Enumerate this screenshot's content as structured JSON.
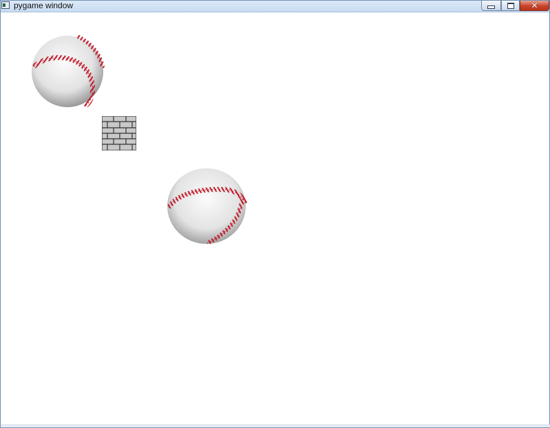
{
  "window": {
    "title": "pygame window",
    "icons": {
      "app": "pygame-app-icon",
      "minimize": "minimize-icon",
      "maximize": "maximize-icon",
      "close": "close-icon"
    },
    "close_color": "#c7432a"
  },
  "scene": {
    "background": "#ffffff",
    "sprites": [
      {
        "kind": "baseball",
        "icon": "baseball-icon"
      },
      {
        "kind": "brick",
        "icon": "brick-wall-icon"
      },
      {
        "kind": "baseball",
        "icon": "baseball-icon"
      }
    ],
    "colors": {
      "ball": "#eeeeee",
      "stitches": "#cc2030",
      "brick": "#c8c8c8",
      "mortar": "#333333"
    }
  }
}
